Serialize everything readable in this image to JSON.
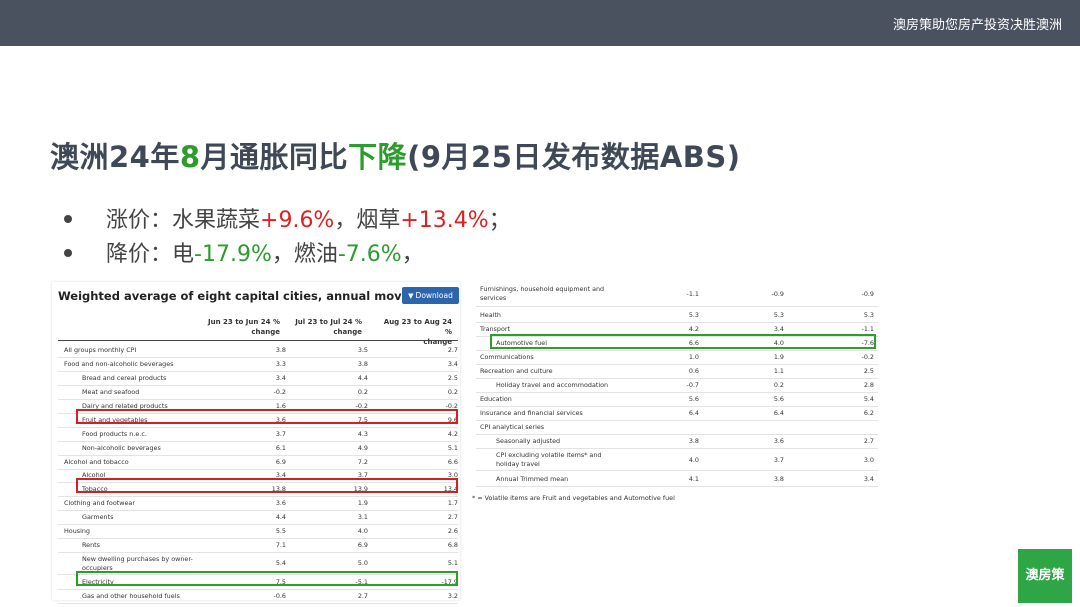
{
  "header": {
    "brand_text": "澳房策助您房产投资决胜澳洲"
  },
  "title": {
    "p1": "澳洲24年",
    "p2": "8",
    "p3": "月通胀同比",
    "p4": "下降",
    "p5": "(9月25日发布数据ABS)"
  },
  "bullets": {
    "b1": {
      "a": "涨价：水果蔬菜",
      "b": "+9.6%",
      "c": "，烟草",
      "d": "+13.4%",
      "e": "；"
    },
    "b2": {
      "a": "降价：电",
      "b": "-17.9%",
      "c": "，燃油",
      "d": "-7.6%",
      "e": "，"
    }
  },
  "left_table": {
    "title": "Weighted average of eight capital cities, annual movement",
    "download_label": "Download",
    "columns": [
      {
        "l1": "Jun 23 to Jun 24 %",
        "l2": "change"
      },
      {
        "l1": "Jul 23 to Jul 24 %",
        "l2": "change"
      },
      {
        "l1": "Aug 23 to Aug 24 %",
        "l2": "change"
      }
    ],
    "rows": [
      {
        "label": "All groups monthly CPI",
        "v": [
          "3.8",
          "3.5",
          "2.7"
        ]
      },
      {
        "label": "Food and non-alcoholic beverages",
        "v": [
          "3.3",
          "3.8",
          "3.4"
        ]
      },
      {
        "label": "Bread and cereal products",
        "v": [
          "3.4",
          "4.4",
          "2.5"
        ]
      },
      {
        "label": "Meat and seafood",
        "v": [
          "-0.2",
          "0.2",
          "0.2"
        ]
      },
      {
        "label": "Dairy and related products",
        "v": [
          "1.6",
          "-0.2",
          "-0.2"
        ]
      },
      {
        "label": "Fruit and vegetables",
        "v": [
          "3.6",
          "7.5",
          "9.6"
        ]
      },
      {
        "label": "Food products n.e.c.",
        "v": [
          "3.7",
          "4.3",
          "4.2"
        ]
      },
      {
        "label": "Non-alcoholic beverages",
        "v": [
          "6.1",
          "4.9",
          "5.1"
        ]
      },
      {
        "label": "Alcohol and tobacco",
        "v": [
          "6.9",
          "7.2",
          "6.6"
        ]
      },
      {
        "label": "Alcohol",
        "v": [
          "3.4",
          "3.7",
          "3.0"
        ]
      },
      {
        "label": "Tobacco",
        "v": [
          "13.8",
          "13.9",
          "13.4"
        ]
      },
      {
        "label": "Clothing and footwear",
        "v": [
          "3.6",
          "1.9",
          "1.7"
        ]
      },
      {
        "label": "Garments",
        "v": [
          "4.4",
          "3.1",
          "2.7"
        ]
      },
      {
        "label": "Housing",
        "v": [
          "5.5",
          "4.0",
          "2.6"
        ]
      },
      {
        "label": "Rents",
        "v": [
          "7.1",
          "6.9",
          "6.8"
        ]
      },
      {
        "label": "New dwelling purchases by owner-",
        "label2": "occupiers",
        "v": [
          "5.4",
          "5.0",
          "5.1"
        ]
      },
      {
        "label": "Electricity",
        "v": [
          "7.5",
          "-5.1",
          "-17.9"
        ]
      },
      {
        "label": "Gas and other household fuels",
        "v": [
          "-0.6",
          "2.7",
          "3.2"
        ]
      }
    ]
  },
  "right_table": {
    "rows": [
      {
        "label": "Furnishings, household equipment and",
        "label2": "services",
        "v": [
          "-1.1",
          "-0.9",
          "-0.9"
        ]
      },
      {
        "label": "Health",
        "v": [
          "5.3",
          "5.3",
          "5.3"
        ]
      },
      {
        "label": "Transport",
        "v": [
          "4.2",
          "3.4",
          "-1.1"
        ]
      },
      {
        "label": "Automotive fuel",
        "v": [
          "6.6",
          "4.0",
          "-7.6"
        ]
      },
      {
        "label": "Communications",
        "v": [
          "1.0",
          "1.9",
          "-0.2"
        ]
      },
      {
        "label": "Recreation and culture",
        "v": [
          "0.6",
          "1.1",
          "2.5"
        ]
      },
      {
        "label": "Holiday travel and accommodation",
        "v": [
          "-0.7",
          "0.2",
          "2.8"
        ]
      },
      {
        "label": "Education",
        "v": [
          "5.6",
          "5.6",
          "5.4"
        ]
      },
      {
        "label": "Insurance and financial services",
        "v": [
          "6.4",
          "6.4",
          "6.2"
        ]
      },
      {
        "label": "CPI analytical series",
        "v": [
          "",
          "",
          ""
        ]
      },
      {
        "label": "Seasonally adjusted",
        "v": [
          "3.8",
          "3.6",
          "2.7"
        ]
      },
      {
        "label": "CPI excluding volatile items* and",
        "label2": "holiday travel",
        "v": [
          "4.0",
          "3.7",
          "3.0"
        ]
      },
      {
        "label": "Annual Trimmed mean",
        "v": [
          "4.1",
          "3.8",
          "3.4"
        ]
      }
    ],
    "footnote": "* = Volatile items are Fruit and vegetables and Automotive fuel"
  },
  "logo": {
    "text": "澳房策"
  },
  "colors": {
    "topbar": "#4a5260",
    "green": "#2e9b2e",
    "red": "#e02020",
    "download_button": "#2a65ad",
    "logo_bg": "#2ea645"
  }
}
